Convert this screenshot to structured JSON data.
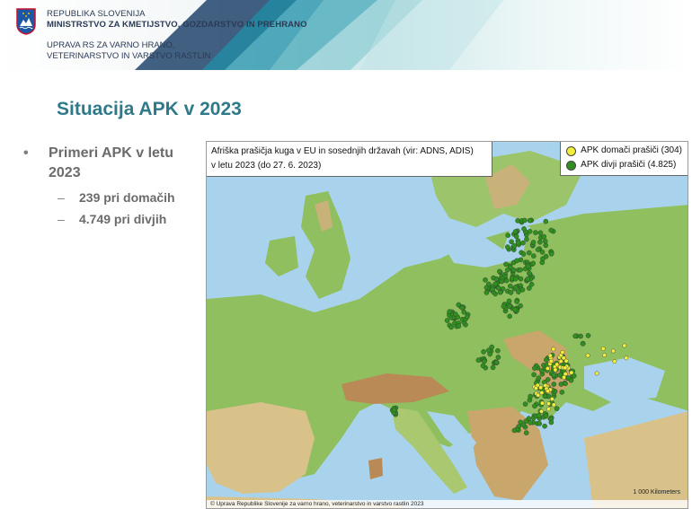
{
  "header": {
    "ministry_line1": "REPUBLIKA SLOVENIJA",
    "ministry_line2": "MINISTRSTVO ZA KMETIJSTVO, GOZDARSTVO IN PREHRANO",
    "agency_line1": "UPRAVA RS ZA VARNO HRANO,",
    "agency_line2": "VETERINARSTVO IN VARSTVO RASTLIN"
  },
  "slide": {
    "title": "Situacija APK v 2023",
    "bullet": "Primeri APK v letu 2023",
    "subs": [
      "239 pri domačih",
      "4.749 pri divjih"
    ]
  },
  "map": {
    "title_line1": "Afriška prašičja kuga v EU in sosednjih državah (vir: ADNS, ADIS)",
    "title_line2": "v letu 2023 (do 27. 6. 2023)",
    "legend": [
      {
        "label": "APK domači prašiči (304)",
        "color": "#f2ee3a"
      },
      {
        "label": "APK divji prašiči (4.825)",
        "color": "#2f8f1f"
      }
    ],
    "scale_label": "1 000 Kilometers",
    "credit": "© Uprava Republike Slovenije za varno hrano, veterinarstvo in varstvo rastlin 2023"
  },
  "colors": {
    "title": "#2f7a8a",
    "sea": "#a9d3ec",
    "lowland": "#8fbf5e",
    "hills": "#d9c28a",
    "mountains": "#b98a56"
  }
}
